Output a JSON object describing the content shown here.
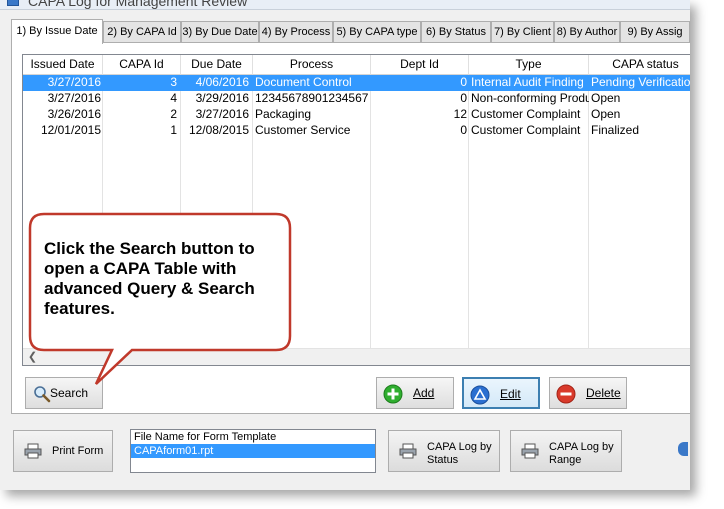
{
  "window": {
    "title": "CAPA Log for Management Review"
  },
  "tabs": [
    {
      "label": "1) By Issue Date",
      "active": true
    },
    {
      "label": "2) By CAPA Id"
    },
    {
      "label": "3) By Due Date"
    },
    {
      "label": "4) By Process"
    },
    {
      "label": "5) By CAPA type"
    },
    {
      "label": "6) By Status"
    },
    {
      "label": "7) By Client"
    },
    {
      "label": "8) By Author"
    },
    {
      "label": "9) By Assig"
    }
  ],
  "grid": {
    "columns": [
      "Issued Date",
      "CAPA Id",
      "Due Date",
      "Process",
      "Dept Id",
      "Type",
      "CAPA status"
    ],
    "rows": [
      {
        "issued": "3/27/2016",
        "capa_id": "3",
        "due": "4/06/2016",
        "process": "Document Control",
        "dept": "0",
        "type": "Internal Audit Finding",
        "status": "Pending Verification",
        "selected": true
      },
      {
        "issued": "3/27/2016",
        "capa_id": "4",
        "due": "3/29/2016",
        "process": "12345678901234567",
        "dept": "0",
        "type": "Non-conforming Product",
        "status": "Open"
      },
      {
        "issued": "3/26/2016",
        "capa_id": "2",
        "due": "3/27/2016",
        "process": "Packaging",
        "dept": "12",
        "type": "Customer Complaint",
        "status": "Open"
      },
      {
        "issued": "12/01/2015",
        "capa_id": "1",
        "due": "12/08/2015",
        "process": "Customer Service",
        "dept": "0",
        "type": "Customer Complaint",
        "status": "Finalized"
      }
    ]
  },
  "buttons": {
    "search": "Search",
    "add": "Add",
    "edit": "Edit",
    "delete": "Delete"
  },
  "bottom": {
    "print_form": "Print Form",
    "template_header": "File Name for Form Template",
    "template_file": "CAPAform01.rpt",
    "log_by_status": [
      "CAPA Log by",
      "Status"
    ],
    "log_by_range": [
      "CAPA Log by",
      "Range"
    ]
  },
  "callout": {
    "text": "Click the Search button to open a CAPA Table with advanced Query & Search features."
  },
  "colors": {
    "selection": "#3399ff",
    "callout_border": "#c0392b",
    "add_icon": "#2fae2f",
    "edit_icon": "#2a6fd0",
    "delete_icon": "#d93a2b"
  }
}
